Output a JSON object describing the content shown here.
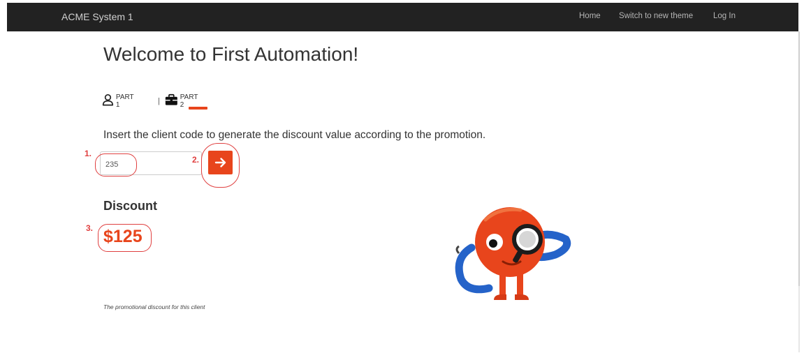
{
  "navbar": {
    "brand": "ACME System 1",
    "links": {
      "home": "Home",
      "theme": "Switch to new theme",
      "login": "Log In"
    }
  },
  "main": {
    "title": "Welcome to First Automation!",
    "tabs": [
      {
        "label": "PART 1",
        "icon": "user-icon",
        "active": false
      },
      {
        "label": "PART 2",
        "icon": "briefcase-icon",
        "active": true
      }
    ],
    "tab_separator": "|",
    "instruction": "Insert the client code to generate the discount value according to the promotion.",
    "client_code_input": {
      "value": "235"
    },
    "discount": {
      "heading": "Discount",
      "value": "$125",
      "note": "The promotional discount for this client"
    }
  },
  "annotations": {
    "step_1": "1.",
    "step_2": "2.",
    "step_3": "3."
  },
  "colors": {
    "accent": "#e8451c",
    "navbar": "#222222",
    "annotation": "#e04040"
  }
}
